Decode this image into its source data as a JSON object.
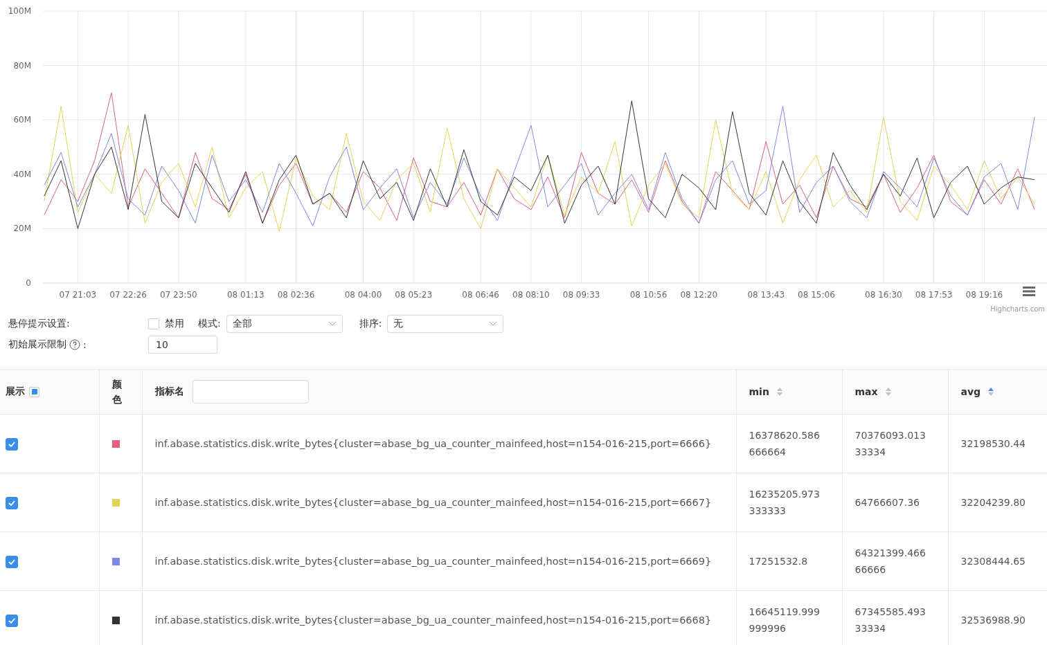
{
  "chart": {
    "credit": "Highcharts.com",
    "chart_data": {
      "type": "line",
      "grid": true,
      "ylim": [
        0,
        100
      ],
      "categories": [
        null,
        null,
        "07 21:03",
        null,
        null,
        "07 22:26",
        null,
        null,
        "07 23:50",
        null,
        null,
        null,
        "08 01:13",
        null,
        null,
        "08 02:36",
        null,
        null,
        null,
        "08 04:00",
        null,
        null,
        "08 05:23",
        null,
        null,
        null,
        "08 06:46",
        null,
        null,
        "08 08:10",
        null,
        null,
        "08 09:33",
        null,
        null,
        null,
        "08 10:56",
        null,
        null,
        "08 12:20",
        null,
        null,
        null,
        "08 13:43",
        null,
        null,
        "08 15:06",
        null,
        null,
        null,
        "08 16:30",
        null,
        null,
        "08 17:53",
        null,
        null,
        "08 19:16",
        null,
        null,
        null
      ],
      "yticks": [
        {
          "value": 0,
          "label": "0"
        },
        {
          "value": 20,
          "label": "20M"
        },
        {
          "value": 40,
          "label": "40M"
        },
        {
          "value": 60,
          "label": "60M"
        },
        {
          "value": 80,
          "label": "80M"
        },
        {
          "value": 100,
          "label": "100M"
        }
      ],
      "series": [
        {
          "color": "#e0607e",
          "values": [
            25,
            38,
            30,
            45,
            70,
            28,
            42,
            33,
            24,
            48,
            31,
            27,
            40,
            22,
            36,
            44,
            29,
            33,
            26,
            41,
            35,
            23,
            46,
            30,
            28,
            37,
            25,
            42,
            31,
            27,
            39,
            24,
            48,
            33,
            29,
            38,
            26,
            45,
            30,
            22,
            41,
            34,
            27,
            52,
            29,
            36,
            24,
            43,
            31,
            28,
            40,
            26,
            35,
            47,
            30,
            25,
            38,
            29,
            42,
            27
          ]
        },
        {
          "color": "#e4d354",
          "values": [
            30,
            65,
            26,
            40,
            33,
            58,
            22,
            37,
            44,
            28,
            50,
            24,
            35,
            41,
            19,
            46,
            32,
            27,
            55,
            30,
            23,
            38,
            44,
            26,
            57,
            31,
            20,
            42,
            35,
            28,
            47,
            25,
            39,
            33,
            52,
            21,
            36,
            44,
            29,
            24,
            60,
            33,
            27,
            41,
            22,
            38,
            47,
            28,
            34,
            26,
            61,
            30,
            23,
            43,
            36,
            27,
            45,
            31,
            39,
            29
          ]
        },
        {
          "color": "#8085e9",
          "values": [
            36,
            48,
            28,
            40,
            55,
            31,
            25,
            43,
            34,
            22,
            47,
            30,
            38,
            26,
            44,
            33,
            21,
            39,
            50,
            27,
            35,
            42,
            24,
            37,
            29,
            46,
            32,
            23,
            41,
            58,
            28,
            36,
            44,
            25,
            33,
            40,
            27,
            48,
            31,
            22,
            38,
            45,
            29,
            34,
            65,
            26,
            37,
            43,
            30,
            24,
            41,
            35,
            28,
            46,
            32,
            25,
            39,
            44,
            27,
            61
          ]
        },
        {
          "color": "#333333",
          "values": [
            32,
            45,
            20,
            40,
            50,
            27,
            62,
            30,
            24,
            44,
            35,
            26,
            41,
            22,
            38,
            47,
            29,
            33,
            24,
            45,
            31,
            37,
            23,
            42,
            28,
            49,
            30,
            25,
            39,
            34,
            47,
            22,
            36,
            43,
            29,
            67,
            31,
            24,
            40,
            35,
            27,
            63,
            33,
            25,
            45,
            30,
            22,
            48,
            36,
            27,
            40,
            32,
            46,
            24,
            37,
            43,
            29,
            35,
            39,
            38
          ]
        }
      ]
    }
  },
  "settings": {
    "hover_label": "悬停提示设置:",
    "disable": {
      "label": "禁用",
      "checked": false
    },
    "mode": {
      "label": "模式:",
      "value": "全部"
    },
    "sort": {
      "label": "排序:",
      "value": "无"
    },
    "limit_label": "初始展示限制",
    "limit_colon": ":",
    "limit_value": "10"
  },
  "table": {
    "show_header": {
      "label": "展示",
      "indeterminate": true
    },
    "color_header": "颜色",
    "name_header": "指标名",
    "stat_columns": [
      {
        "label": "min",
        "sorted_ascending": false
      },
      {
        "label": "max",
        "sorted_ascending": false
      },
      {
        "label": "avg",
        "sorted_ascending": true
      }
    ],
    "rows": [
      {
        "shown": true,
        "color": "#e0607e",
        "name": "inf.abase.statistics.disk.write_bytes{cluster=abase_bg_ua_counter_mainfeed,host=n154-016-215,port=6666}",
        "min": "16378620.586666664",
        "max": "70376093.01333334",
        "avg": "32198530.44"
      },
      {
        "shown": true,
        "color": "#e4d354",
        "name": "inf.abase.statistics.disk.write_bytes{cluster=abase_bg_ua_counter_mainfeed,host=n154-016-215,port=6667}",
        "min": "16235205.973333333",
        "max": "64766607.36",
        "avg": "32204239.80"
      },
      {
        "shown": true,
        "color": "#8085e9",
        "name": "inf.abase.statistics.disk.write_bytes{cluster=abase_bg_ua_counter_mainfeed,host=n154-016-215,port=6669}",
        "min": "17251532.8",
        "max": "64321399.46666666",
        "avg": "32308444.65"
      },
      {
        "shown": true,
        "color": "#333333",
        "name": "inf.abase.statistics.disk.write_bytes{cluster=abase_bg_ua_counter_mainfeed,host=n154-016-215,port=6668}",
        "min": "16645119.999999996",
        "max": "67345585.49333334",
        "avg": "32536988.90"
      }
    ]
  }
}
